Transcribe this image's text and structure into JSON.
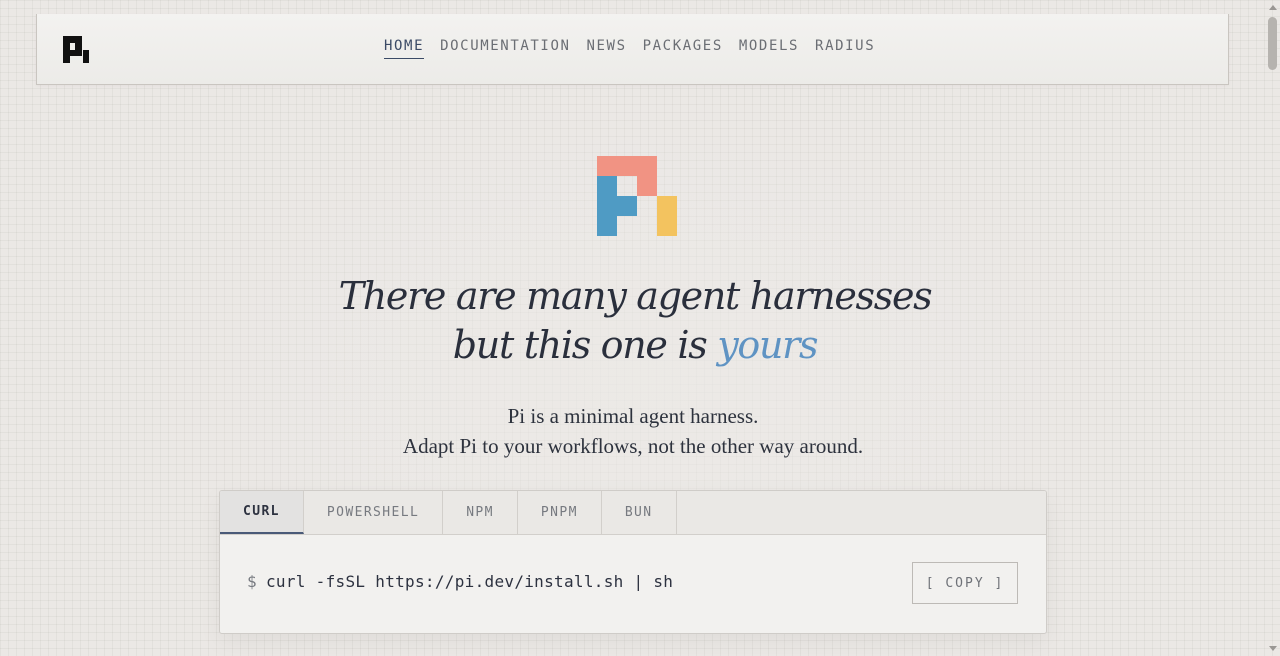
{
  "header": {
    "logo_icon": "pi-logo-icon",
    "nav": [
      {
        "label": "HOME",
        "active": true
      },
      {
        "label": "DOCUMENTATION",
        "active": false
      },
      {
        "label": "NEWS",
        "active": false
      },
      {
        "label": "PACKAGES",
        "active": false
      },
      {
        "label": "MODELS",
        "active": false
      },
      {
        "label": "RADIUS",
        "active": false
      }
    ]
  },
  "hero": {
    "logo_icon": "pi-color-logo-icon",
    "logo_colors": {
      "top": "#f19383",
      "left": "#4f9bc4",
      "right": "#f3c35f"
    },
    "headline_line1": "There are many agent harnesses",
    "headline_line2_prefix": "but this one is",
    "headline_line2_accent": "yours",
    "accent_color": "#5f93c3",
    "tagline_line1": "Pi is a minimal agent harness.",
    "tagline_line2": "Adapt Pi to your workflows, not the other way around."
  },
  "install": {
    "tabs": [
      {
        "label": "CURL",
        "active": true
      },
      {
        "label": "POWERSHELL",
        "active": false
      },
      {
        "label": "NPM",
        "active": false
      },
      {
        "label": "PNPM",
        "active": false
      },
      {
        "label": "BUN",
        "active": false
      }
    ],
    "prompt": "$",
    "command": "curl -fsSL https://pi.dev/install.sh | sh",
    "copy_label": "[ COPY ]"
  }
}
